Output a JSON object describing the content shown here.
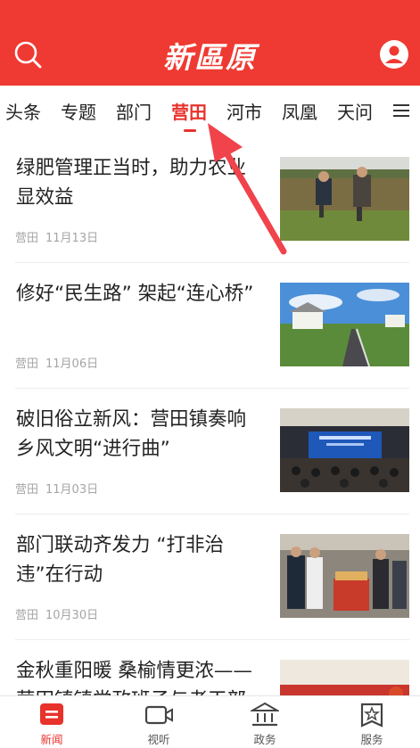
{
  "header": {
    "logo": "新區原",
    "search_icon": "search-icon",
    "user_icon": "user-icon",
    "color": "#ee3a32"
  },
  "tabs": [
    {
      "label": "头条"
    },
    {
      "label": "专题"
    },
    {
      "label": "部门"
    },
    {
      "label": "营田",
      "active": true
    },
    {
      "label": "河市"
    },
    {
      "label": "凤凰"
    },
    {
      "label": "天问"
    }
  ],
  "menu_icon": "hamburger-menu-icon",
  "news": [
    {
      "title": "绿肥管理正当时，助力农业显效益",
      "source": "营田",
      "date": "11月13日",
      "thumb": "farm-field-image"
    },
    {
      "title": "修好“民生路” 架起“连心桥”",
      "source": "营田",
      "date": "11月06日",
      "thumb": "rural-road-image"
    },
    {
      "title": "破旧俗立新风：营田镇奏响乡风文明“进行曲”",
      "source": "营田",
      "date": "11月03日",
      "thumb": "meeting-hall-image"
    },
    {
      "title": "部门联动齐发力 “打非治违”在行动",
      "source": "营田",
      "date": "10月30日",
      "thumb": "inspection-image"
    },
    {
      "title": "金秋重阳暖 桑榆情更浓——营田镇镇党政班子与老干部",
      "source": "",
      "date": "",
      "thumb": "celebration-image"
    }
  ],
  "bottom_nav": [
    {
      "label": "新闻",
      "icon": "news-icon",
      "active": true
    },
    {
      "label": "视听",
      "icon": "video-icon"
    },
    {
      "label": "政务",
      "icon": "government-icon"
    },
    {
      "label": "服务",
      "icon": "service-icon"
    }
  ],
  "accent": "#e8322c"
}
